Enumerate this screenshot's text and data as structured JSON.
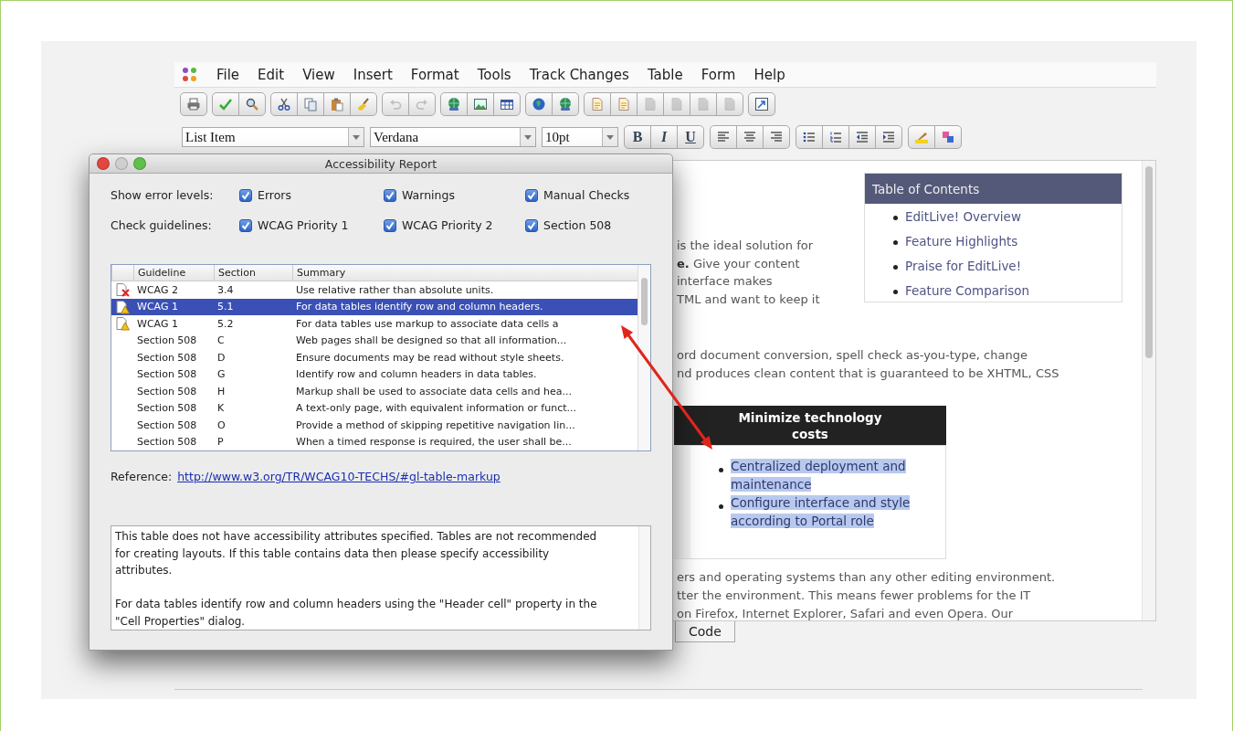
{
  "editor": {
    "menu": [
      "File",
      "Edit",
      "View",
      "Insert",
      "Format",
      "Tools",
      "Track Changes",
      "Table",
      "Form",
      "Help"
    ],
    "toolbar": [
      [
        {
          "kind": "print",
          "disabled": false
        }
      ],
      [
        {
          "kind": "spellcheck",
          "disabled": false
        },
        {
          "kind": "find",
          "disabled": false
        }
      ],
      [
        {
          "kind": "cut",
          "disabled": false
        },
        {
          "kind": "copy",
          "disabled": false
        },
        {
          "kind": "paste",
          "disabled": false
        },
        {
          "kind": "clean",
          "disabled": false
        }
      ],
      [
        {
          "kind": "undo",
          "disabled": true
        },
        {
          "kind": "redo",
          "disabled": true
        }
      ],
      [
        {
          "kind": "link",
          "disabled": false
        },
        {
          "kind": "image",
          "disabled": false
        },
        {
          "kind": "table",
          "disabled": false
        }
      ],
      [
        {
          "kind": "web",
          "disabled": false
        },
        {
          "kind": "link",
          "disabled": false
        }
      ],
      [
        {
          "kind": "note",
          "disabled": false
        },
        {
          "kind": "note",
          "disabled": false
        },
        {
          "kind": "page",
          "disabled": true
        },
        {
          "kind": "page",
          "disabled": true
        },
        {
          "kind": "page",
          "disabled": true
        },
        {
          "kind": "page",
          "disabled": true
        }
      ],
      [
        {
          "kind": "fullscreen",
          "disabled": false
        }
      ]
    ],
    "format_bar": {
      "paragraph_style": "List Item",
      "font": "Verdana",
      "size": "10pt",
      "style_buttons": [
        "B",
        "I",
        "U"
      ]
    },
    "document": {
      "intro_lines": [
        "is the ideal solution for",
        "**e.** Give your content",
        "interface makes",
        "TML and want to keep it"
      ],
      "toc": {
        "title": "Table of Contents",
        "items": [
          "EditLive! Overview",
          "Feature Highlights",
          "Praise for EditLive!",
          "Feature Comparison"
        ]
      },
      "feature_lines": [
        "ord document conversion, spell check as-you-type, change",
        "nd produces clean content that is guaranteed to be XHTML, CSS"
      ],
      "feature_table": {
        "title": "Minimize technology costs",
        "items": [
          {
            "text": "Centralized deployment and maintenance",
            "selected": true
          },
          {
            "text": "Configure interface and style according to Portal role",
            "selected": true
          }
        ]
      },
      "closing_lines": [
        "ers and operating systems than any other editing environment.",
        "tter the environment. This means fewer problems for the IT",
        "on Firefox, Internet Explorer, Safari and even Opera. Our"
      ]
    },
    "code_button": "Code"
  },
  "dialog": {
    "title": "Accessibility Report",
    "error_levels": {
      "label": "Show error levels:",
      "options": [
        {
          "label": "Errors",
          "checked": true
        },
        {
          "label": "Warnings",
          "checked": true
        },
        {
          "label": "Manual Checks",
          "checked": true
        }
      ]
    },
    "guidelines": {
      "label": "Check guidelines:",
      "options": [
        {
          "label": "WCAG Priority 1",
          "checked": true
        },
        {
          "label": "WCAG Priority 2",
          "checked": true
        },
        {
          "label": "Section 508",
          "checked": true
        }
      ]
    },
    "report": {
      "columns": [
        "Guideline",
        "Section",
        "Summary"
      ],
      "rows": [
        {
          "kind": "error",
          "guideline": "WCAG 2",
          "section": "3.4",
          "summary": "Use relative rather than absolute units.",
          "selected": false
        },
        {
          "kind": "warning",
          "guideline": "WCAG 1",
          "section": "5.1",
          "summary": "For data tables identify row and column headers.",
          "selected": true
        },
        {
          "kind": "warning",
          "guideline": "WCAG 1",
          "section": "5.2",
          "summary": "For data tables use markup to associate data cells a",
          "selected": false
        },
        {
          "kind": "none",
          "guideline": "Section 508",
          "section": "C",
          "summary": "Web pages shall be designed so that all information...",
          "selected": false
        },
        {
          "kind": "none",
          "guideline": "Section 508",
          "section": "D",
          "summary": "Ensure documents may be read without style sheets.",
          "selected": false
        },
        {
          "kind": "none",
          "guideline": "Section 508",
          "section": "G",
          "summary": "Identify row and column headers in data tables.",
          "selected": false
        },
        {
          "kind": "none",
          "guideline": "Section 508",
          "section": "H",
          "summary": "Markup shall be used to associate data cells and hea...",
          "selected": false
        },
        {
          "kind": "none",
          "guideline": "Section 508",
          "section": "K",
          "summary": "A text-only page, with equivalent information or funct...",
          "selected": false
        },
        {
          "kind": "none",
          "guideline": "Section 508",
          "section": "O",
          "summary": "Provide a method of skipping repetitive navigation lin...",
          "selected": false
        },
        {
          "kind": "none",
          "guideline": "Section 508",
          "section": "P",
          "summary": "When a timed response is required, the user shall be...",
          "selected": false
        }
      ]
    },
    "reference": {
      "label": "Reference:",
      "link": "http://www.w3.org/TR/WCAG10-TECHS/#gl-table-markup"
    },
    "details": [
      "This table does not have accessibility attributes specified. Tables are not recommended for creating layouts. If this table contains data then please specify accessibility attributes.",
      "For data tables identify row and column headers using the \"Header cell\" property in the \"Cell Properties\" dialog."
    ]
  }
}
